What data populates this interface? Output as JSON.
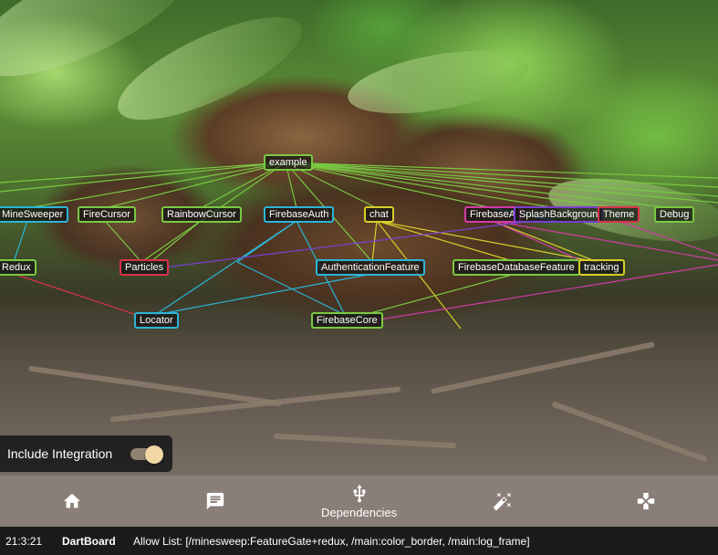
{
  "graph": {
    "nodes": {
      "example": "example",
      "minesweeper": "MineSweeper",
      "firecursor": "FireCursor",
      "rainbowcursor": "RainbowCursor",
      "firebaseauth": "FirebaseAuth",
      "chat": "chat",
      "firebasea": "FirebaseA",
      "splashbackground": "SplashBackgroun",
      "theme": "Theme",
      "debug": "Debug",
      "redux": "Redux",
      "particles": "Particles",
      "authenticationfeature": "AuthenticationFeature",
      "firebasedatabasefeature": "FirebaseDatabaseFeature",
      "tracking": "tracking",
      "locator": "Locator",
      "firebasecore": "FirebaseCore"
    }
  },
  "integration": {
    "label": "Include Integration",
    "enabled": true
  },
  "bottom_nav": {
    "items": [
      {
        "icon": "home-icon",
        "label": ""
      },
      {
        "icon": "chat-icon",
        "label": ""
      },
      {
        "icon": "usb-icon",
        "label": "Dependencies",
        "active": true
      },
      {
        "icon": "magic-wand-icon",
        "label": ""
      },
      {
        "icon": "gamepad-icon",
        "label": ""
      }
    ]
  },
  "status_bar": {
    "time": "21:3:21",
    "app": "DartBoard",
    "message": "Allow List: [/minesweep:FeatureGate+redux, /main:color_border, /main:log_frame]"
  },
  "colors": {
    "nav_bg": "#8a7e78",
    "status_bg": "#1b1b1b",
    "toggle_thumb": "#f0d7a4",
    "edge_green": "#7ac943",
    "edge_cyan": "#2bb5d8",
    "edge_olive": "#d7cf2a",
    "edge_magenta": "#d23ba6",
    "edge_purple": "#7a3fd0"
  }
}
